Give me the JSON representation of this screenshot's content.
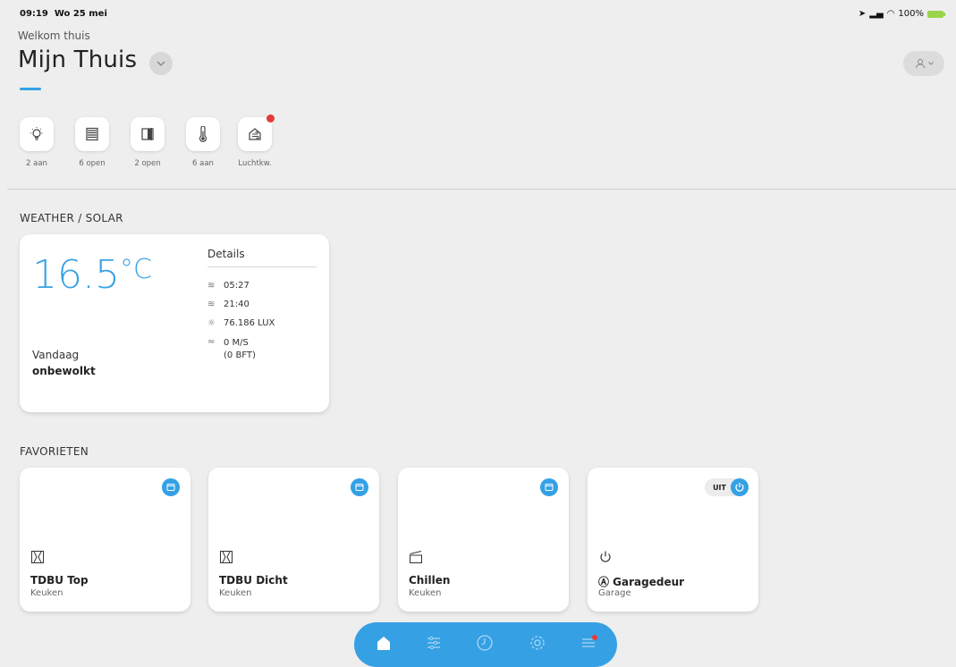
{
  "status": {
    "time": "09:19",
    "date": "Wo 25 mei",
    "battery": "100%"
  },
  "header": {
    "subtitle": "Welkom thuis",
    "title": "Mijn Thuis"
  },
  "quick_actions": [
    {
      "icon": "light-bulb-icon",
      "label": "2 aan"
    },
    {
      "icon": "blinds-icon",
      "label": "6 open"
    },
    {
      "icon": "door-icon",
      "label": "2 open"
    },
    {
      "icon": "thermometer-icon",
      "label": "6 aan"
    },
    {
      "icon": "air-quality-icon",
      "label": "Luchtkw.",
      "alert": true
    }
  ],
  "weather": {
    "section_title": "WEATHER / SOLAR",
    "temperature": "16.5",
    "unit": "°C",
    "today_label": "Vandaag",
    "today_value": "onbewolkt",
    "details_title": "Details",
    "details": [
      {
        "icon": "sunrise-icon",
        "text": "05:27"
      },
      {
        "icon": "sunset-icon",
        "text": "21:40"
      },
      {
        "icon": "sun-icon",
        "text": "76.186 LUX"
      },
      {
        "icon": "wind-icon",
        "text": "0 M/S"
      },
      {
        "icon": "",
        "text": "(0 BFT)"
      }
    ]
  },
  "favorites": {
    "section_title": "FAVORIETEN",
    "items": [
      {
        "name": "TDBU Top",
        "room": "Keuken",
        "icon": "window-blind-icon"
      },
      {
        "name": "TDBU Dicht",
        "room": "Keuken",
        "icon": "window-blind-icon"
      },
      {
        "name": "Chillen",
        "room": "Keuken",
        "icon": "scene-icon"
      },
      {
        "name": "Ⓐ Garagedeur",
        "room": "Garage",
        "icon": "power-icon",
        "state": "UIT"
      }
    ]
  },
  "nav": [
    "home-icon",
    "controls-icon",
    "clock-icon",
    "settings-icon",
    "menu-icon"
  ],
  "colors": {
    "accent": "#34a1e6",
    "alert": "#e23b3b"
  }
}
